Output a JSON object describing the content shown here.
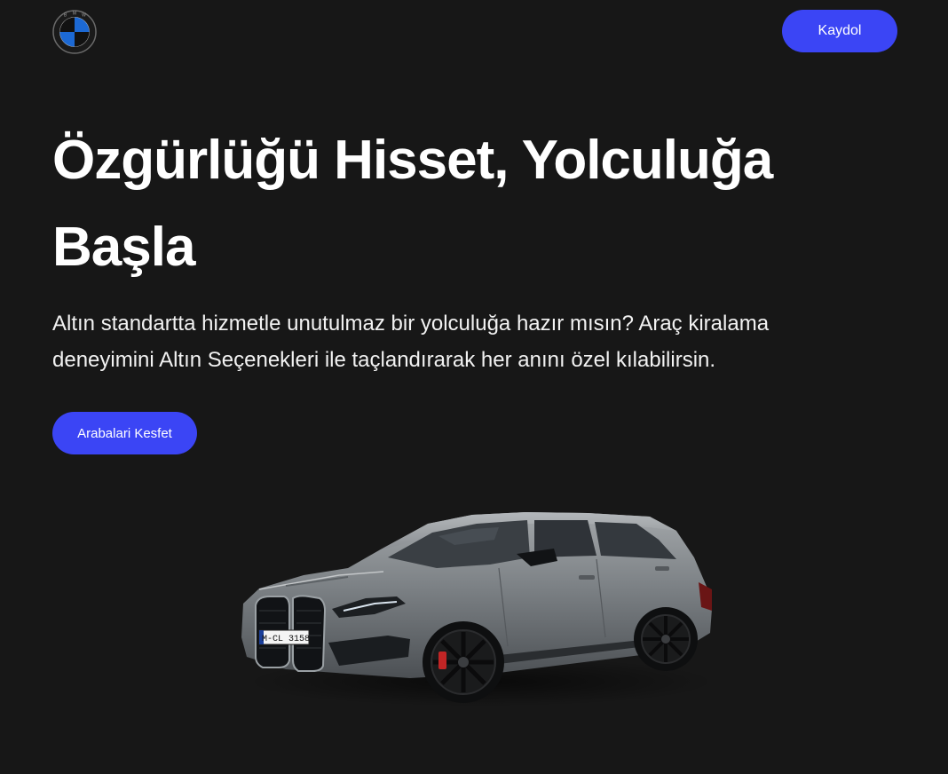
{
  "header": {
    "logo_letters": [
      "B",
      "M",
      "W"
    ],
    "signup_label": "Kaydol"
  },
  "hero": {
    "title_line1": "Özgürlüğü Hisset, Yolculuğa",
    "title_line2": "Başla",
    "text_line1": "Altın standartta hizmetle unutulmaz bir yolculuğa hazır mısın? Araç kiralama",
    "text_line2": "deneyimini Altın Seçenekleri ile taçlandırarak her anını özel kılabilirsin.",
    "cta_label": "Arabalari Kesfet"
  },
  "car": {
    "plate": "M-CL 3158",
    "body_color": "#7c8185"
  },
  "colors": {
    "background": "#171717",
    "accent": "#3b45f5",
    "logo_blue": "#1c69d4"
  }
}
